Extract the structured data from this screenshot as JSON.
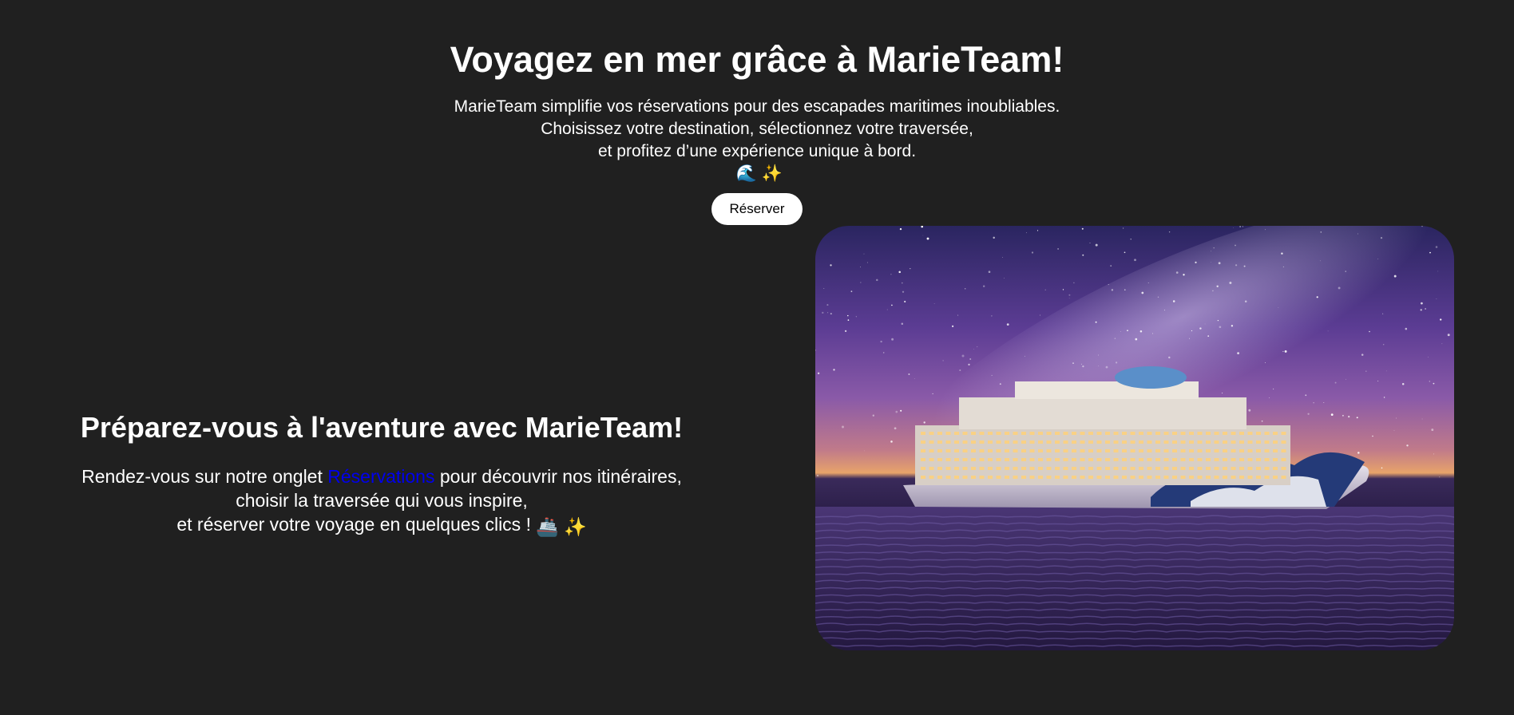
{
  "hero": {
    "title": "Voyagez en mer grâce à MarieTeam!",
    "lead_line_1": "MarieTeam simplifie vos réservations pour des escapades maritimes inoubliables.",
    "lead_line_2": "Choisissez votre destination, sélectionnez votre traversée,",
    "lead_line_3": "et profitez d’une expérience unique à bord.",
    "lead_emoji": "🌊 ✨",
    "button_label": "Réserver"
  },
  "intro": {
    "title": "Préparez-vous à l'aventure avec MarieTeam!",
    "line_1_before": "Rendez-vous sur notre onglet ",
    "line_1_link": "Réservations",
    "line_1_after": " pour découvrir nos itinéraires,",
    "line_2": "choisir la traversée qui vous inspire,",
    "line_3": "et réserver votre voyage en quelques clics !",
    "line_3_emoji": "🚢 ✨"
  },
  "image": {
    "subject": "cruise ship at sea under a starry purple night sky"
  },
  "colors": {
    "background": "#202020",
    "text": "#ffffff",
    "link": "#0000ee",
    "button_bg": "#ffffff",
    "button_text": "#000000"
  }
}
